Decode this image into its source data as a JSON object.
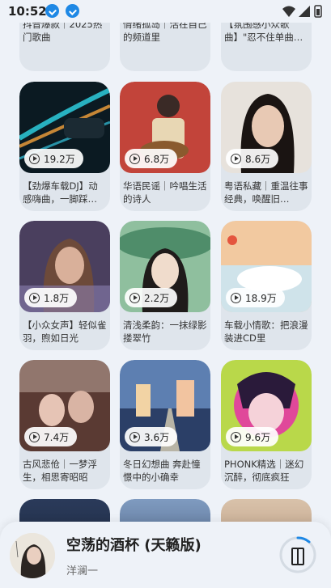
{
  "status_bar": {
    "time": "10:52"
  },
  "cards": [
    {
      "title": "抖音爆款｜2025热门歌曲",
      "plays": ""
    },
    {
      "title": "情绪孤岛｜活在自己的频道里",
      "plays": ""
    },
    {
      "title": "【氛围感小众歌曲】\"忍不住单曲…",
      "plays": ""
    },
    {
      "title": "【劲爆车载DJ】动感嗨曲，一脚踩…",
      "plays": "19.2万"
    },
    {
      "title": "华语民谣｜吟唱生活的诗人",
      "plays": "6.8万"
    },
    {
      "title": "粤语私藏｜重温往事经典，唤醒旧…",
      "plays": "8.6万"
    },
    {
      "title": "【小众女声】轻似雀羽，煦如日光",
      "plays": "1.8万"
    },
    {
      "title": "清浅柔韵：一抹绿影搂翠竹",
      "plays": "2.2万"
    },
    {
      "title": "车载小情歌：把浪漫装进CD里",
      "plays": "18.9万"
    },
    {
      "title": "古风悲伧｜一梦浮生，相思寄昭昭",
      "plays": "7.4万"
    },
    {
      "title": "冬日幻想曲 奔赴憧憬中的小确幸",
      "plays": "3.6万"
    },
    {
      "title": "PHONK精选｜迷幻沉醉，彻底疯狂",
      "plays": "9.6万"
    }
  ],
  "mini_player": {
    "title": "空荡的酒杯 (天籁版)",
    "artist": "洋澜一"
  },
  "colors": {
    "background": "#eef2f8",
    "card": "#dfe5ec",
    "accent": "#1e88e5"
  }
}
